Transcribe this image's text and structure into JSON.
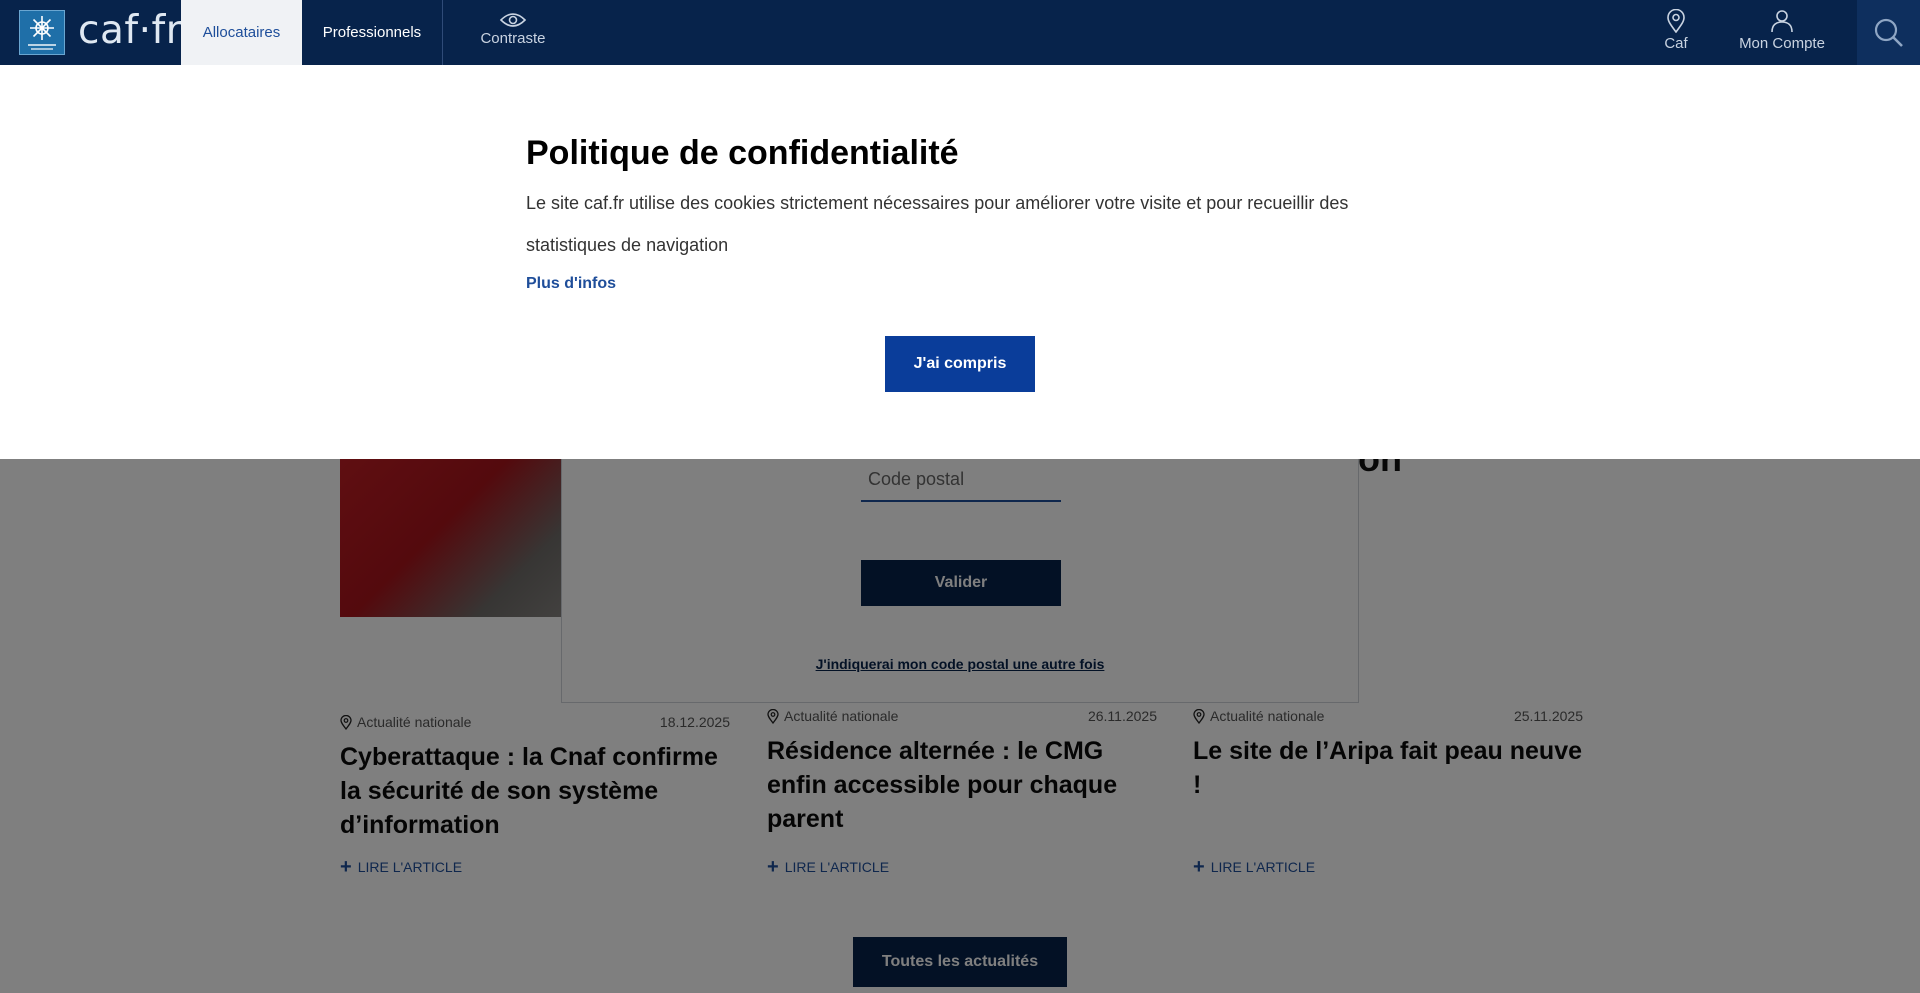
{
  "header": {
    "logo_text": "caf·fr",
    "tabs": [
      {
        "label": "Allocataires"
      },
      {
        "label": "Professionnels"
      }
    ],
    "contrast_label": "Contraste",
    "caf_label": "Caf",
    "account_label": "Mon Compte"
  },
  "cookie_banner": {
    "title": "Politique de confidentialité",
    "text": "Le site caf.fr utilise des cookies strictement nécessaires pour améliorer votre visite et pour recueillir des statistiques de navigation",
    "more_link": "Plus d'infos",
    "accept_button": "J'ai compris"
  },
  "postal_modal": {
    "placeholder": "Code postal",
    "submit_button": "Valider",
    "later_link": "J'indiquerai mon code postal une autre fois"
  },
  "hero": {
    "visible_fragment": "on"
  },
  "articles": [
    {
      "category": "Actualité nationale",
      "date": "18.12.2025",
      "title": "Cyberattaque : la Cnaf confirme la sécurité de son système d’information",
      "link": "LIRE L'ARTICLE"
    },
    {
      "category": "Actualité nationale",
      "date": "26.11.2025",
      "title": "Résidence alternée : le CMG enfin accessible pour chaque parent",
      "link": "LIRE L'ARTICLE"
    },
    {
      "category": "Actualité nationale",
      "date": "25.11.2025",
      "title": "Le site de l’Aripa fait peau neuve !",
      "link": "LIRE L'ARTICLE"
    }
  ],
  "all_news_button": "Toutes les actualités",
  "colors": {
    "header_bg": "#07234b",
    "accent_blue": "#0a3d9a",
    "link_blue": "#1f4e9a"
  }
}
